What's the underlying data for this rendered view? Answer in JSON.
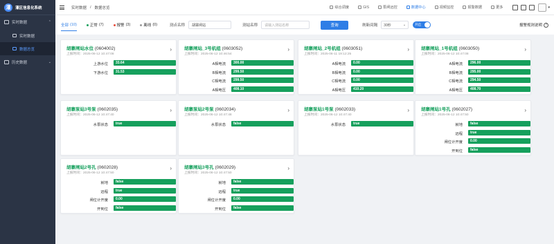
{
  "app": {
    "title": "灌区信息化系统",
    "logo_char": "灌"
  },
  "sidebar": {
    "groups": [
      {
        "label": "实时数据",
        "expanded": true,
        "items": [
          {
            "label": "实时数据",
            "active": false
          },
          {
            "label": "数据总览",
            "active": true
          }
        ]
      },
      {
        "label": "历史数据",
        "expanded": false,
        "items": []
      }
    ]
  },
  "breadcrumb": [
    "实时数据",
    "数据总览"
  ],
  "topnav": [
    {
      "label": "综合调度",
      "active": false
    },
    {
      "label": "GIS",
      "active": false
    },
    {
      "label": "泵闸远控",
      "active": false
    },
    {
      "label": "数据中心",
      "active": true
    },
    {
      "label": "视频监控",
      "active": false
    },
    {
      "label": "报警数据",
      "active": false
    },
    {
      "label": "更多",
      "active": false
    }
  ],
  "tabs": [
    {
      "label": "全部",
      "count": "(10)",
      "active": true,
      "dot": ""
    },
    {
      "label": "正常",
      "count": "(7)",
      "active": false,
      "dot": "#16a05d"
    },
    {
      "label": "报警",
      "count": "(3)",
      "active": false,
      "dot": "#e74c3c"
    },
    {
      "label": "离线",
      "count": "(0)",
      "active": false,
      "dot": "#999999"
    }
  ],
  "filter": {
    "station_label": "测点名称",
    "station_value": "胡寨闸站",
    "name_label": "测站名称",
    "name_placeholder": "请输入测站名称",
    "query_button": "查询",
    "refresh_label": "刷新间隔",
    "refresh_value": "30秒",
    "toggle_label": "开启",
    "alarm_help": "报警规则说明"
  },
  "colors": {
    "accent": "#2f7ee6",
    "ok": "#16a05d"
  },
  "cards": [
    {
      "title": "胡寨闸站水位",
      "code": "(0604002)",
      "time": "上报时间：2025-06-12 10:47:08",
      "rows": [
        {
          "label": "上游水位",
          "value": "33.64"
        },
        {
          "label": "下游水位",
          "value": "31.53"
        }
      ]
    },
    {
      "title": "胡寨闸站_3号机组",
      "code": "(0603052)",
      "time": "上报时间：2025-06-12 10:46:54",
      "rows": [
        {
          "label": "A相电流",
          "value": "300.00"
        },
        {
          "label": "B相电流",
          "value": "299.50"
        },
        {
          "label": "C相电流",
          "value": "299.50"
        },
        {
          "label": "A相电压",
          "value": "408.10"
        }
      ]
    },
    {
      "title": "胡寨闸站_2号机组",
      "code": "(0603051)",
      "time": "上报时间：2025-06-11 19:12:25",
      "rows": [
        {
          "label": "A相电流",
          "value": "0.00"
        },
        {
          "label": "B相电流",
          "value": "0.00"
        },
        {
          "label": "C相电流",
          "value": "0.00"
        },
        {
          "label": "A相电压",
          "value": "410.20"
        }
      ]
    },
    {
      "title": "胡寨闸站_1号机组",
      "code": "(0603050)",
      "time": "上报时间：2025-06-12 10:47:08",
      "rows": [
        {
          "label": "A相电流",
          "value": "296.00"
        },
        {
          "label": "B相电流",
          "value": "295.00"
        },
        {
          "label": "C相电流",
          "value": "294.50"
        },
        {
          "label": "A相电压",
          "value": "408.70"
        }
      ]
    },
    {
      "title": "胡寨泵站3号泵",
      "code": "(0602035)",
      "time": "上报时间：2025-06-12 10:47:40",
      "rows": [
        {
          "label": "水泵状态",
          "value": "true"
        }
      ]
    },
    {
      "title": "胡寨泵站2号泵",
      "code": "(0602034)",
      "time": "上报时间：2025-06-12 10:47:48",
      "rows": [
        {
          "label": "水泵状态",
          "value": "false"
        }
      ]
    },
    {
      "title": "胡寨泵站1号泵",
      "code": "(0602033)",
      "time": "上报时间：2025-06-12 10:47:40",
      "rows": [
        {
          "label": "水泵状态",
          "value": "true"
        }
      ]
    },
    {
      "title": "胡寨闸站1号孔",
      "code": "(0602027)",
      "time": "上报时间：2025-06-12 10:47:50",
      "rows": [
        {
          "label": "就地",
          "value": "false"
        },
        {
          "label": "远程",
          "value": "true"
        },
        {
          "label": "闸位计开度",
          "value": "0.00"
        },
        {
          "label": "开到位",
          "value": "false"
        }
      ]
    },
    {
      "title": "胡寨闸站2号孔",
      "code": "(0602028)",
      "time": "上报时间：2025-06-12 10:47:50",
      "rows": [
        {
          "label": "就地",
          "value": "false"
        },
        {
          "label": "远程",
          "value": "true"
        },
        {
          "label": "闸位计开度",
          "value": "0.00"
        },
        {
          "label": "开到位",
          "value": "false"
        }
      ]
    },
    {
      "title": "胡寨闸站3号孔",
      "code": "(0602029)",
      "time": "上报时间：2025-06-12 10:47:50",
      "rows": [
        {
          "label": "就地",
          "value": "false"
        },
        {
          "label": "远程",
          "value": "true"
        },
        {
          "label": "闸位计开度",
          "value": "0.00"
        },
        {
          "label": "开到位",
          "value": "false"
        }
      ]
    }
  ]
}
